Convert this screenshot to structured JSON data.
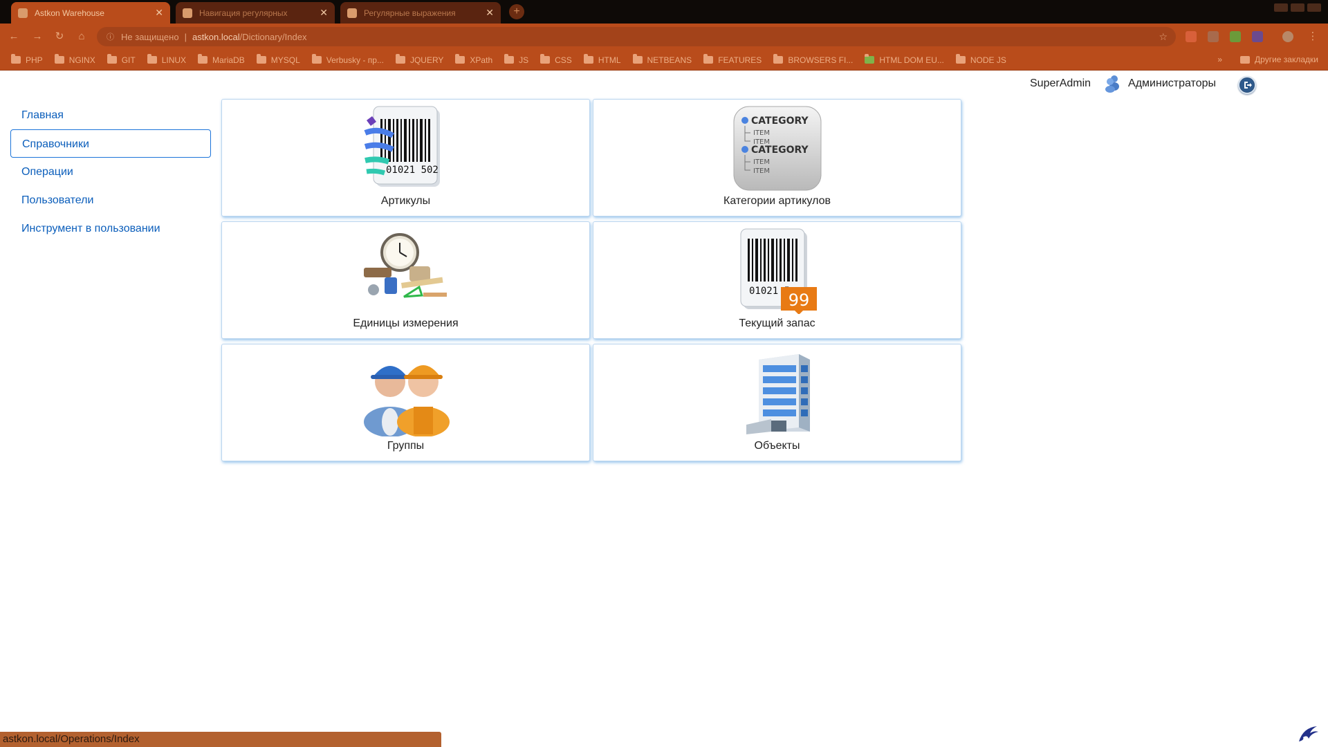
{
  "browser": {
    "tabs": [
      {
        "title": "Astkon Warehouse",
        "active": true
      },
      {
        "title": "Навигация регулярных",
        "active": false
      },
      {
        "title": "Регулярные выражения",
        "active": false
      }
    ],
    "new_tab": "+",
    "address": {
      "security": "Не защищено",
      "host": "astkon.local",
      "path": "/Dictionary/Index"
    },
    "bookmarks": [
      "PHP",
      "NGINX",
      "GIT",
      "LINUX",
      "MariaDB",
      "MYSQL",
      "Verbusky - пр...",
      "JQUERY",
      "XPath",
      "JS",
      "CSS",
      "HTML",
      "NETBEANS",
      "FEATURES",
      "BROWSERS FI...",
      "HTML DOM EU...",
      "NODE JS"
    ],
    "bookmarks_more": "»",
    "other_bookmarks": "Другие закладки"
  },
  "header": {
    "user": "SuperAdmin",
    "group": "Администраторы"
  },
  "sidebar": {
    "items": [
      {
        "label": "Главная"
      },
      {
        "label": "Справочники"
      },
      {
        "label": "Операции"
      },
      {
        "label": "Пользователи"
      },
      {
        "label": "Инструмент в пользовании"
      }
    ]
  },
  "tiles": [
    {
      "label": "Артикулы",
      "icon": "barcode-articles-icon",
      "barcode": "01021 502"
    },
    {
      "label": "Категории артикулов",
      "icon": "category-list-icon",
      "category": "CATEGORY",
      "item": "ITEM"
    },
    {
      "label": "Единицы измерения",
      "icon": "measuring-tools-icon"
    },
    {
      "label": "Текущий запас",
      "icon": "barcode-stock-icon",
      "barcode": "01021 5",
      "badge": "99"
    },
    {
      "label": "Группы",
      "icon": "workers-group-icon"
    },
    {
      "label": "Объекты",
      "icon": "office-building-icon"
    }
  ],
  "status_bar": "astkon.local/Operations/Index",
  "colors": {
    "link": "#0b5ebb",
    "active_border": "#1a73d9",
    "tile_shadow": "#4696dc",
    "chrome": "#b94c1b"
  }
}
